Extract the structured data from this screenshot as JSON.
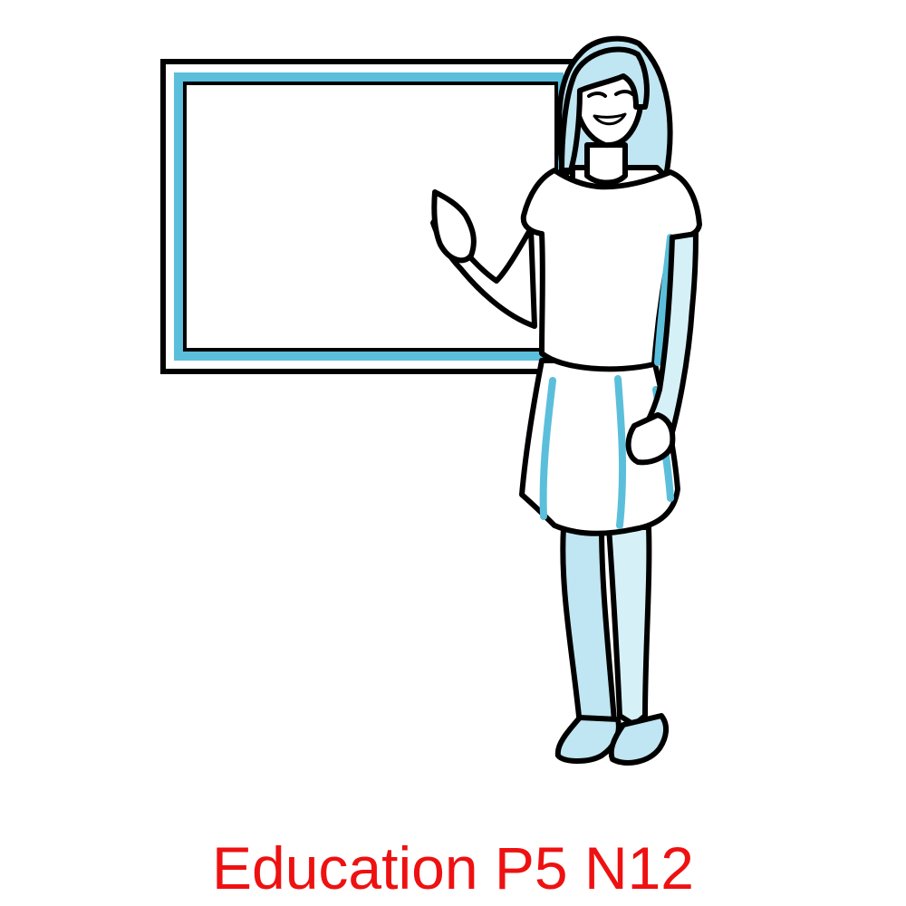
{
  "caption": "Education P5 N12",
  "colors": {
    "caption": "#ee1111",
    "outline": "#000000",
    "accent": "#5bbfdb",
    "background": "#ffffff"
  },
  "illustration": {
    "subject": "girl-presenting-at-board",
    "icon": "board-icon"
  }
}
